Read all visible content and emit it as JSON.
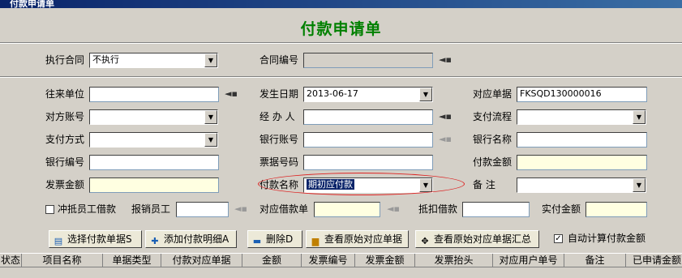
{
  "window": {
    "title": "付款申请单"
  },
  "header": {
    "title": "付款申请单"
  },
  "top": {
    "contract_label": "执行合同",
    "contract_value": "不执行",
    "contract_no_label": "合同编号",
    "contract_no_value": ""
  },
  "form": {
    "partner_label": "往来单位",
    "partner_value": "",
    "date_label": "发生日期",
    "date_value": "2013-06-17",
    "doc_label": "对应单据",
    "doc_value": "FKSQD130000016",
    "account_label": "对方账号",
    "account_value": "",
    "handler_label": "经 办 人",
    "handler_value": "",
    "flow_label": "支付流程",
    "flow_value": "",
    "paymethod_label": "支付方式",
    "paymethod_value": "",
    "bank_account_label": "银行账号",
    "bank_account_value": "",
    "bank_name_label": "银行名称",
    "bank_name_value": "",
    "bank_no_label": "银行编号",
    "bank_no_value": "",
    "bill_no_label": "票据号码",
    "bill_no_value": "",
    "pay_amount_label": "付款金额",
    "pay_amount_value": "",
    "invoice_amount_label": "发票金额",
    "invoice_amount_value": "",
    "pay_name_label": "付款名称",
    "pay_name_value": "期初应付款",
    "remark_label": "备  注",
    "remark_value": "",
    "offset_label": "冲抵员工借款",
    "offset_checked": false,
    "reimburse_label": "报销员工",
    "reimburse_value": "",
    "loan_doc_label": "对应借款单",
    "loan_doc_value": "",
    "deduct_label": "抵扣借款",
    "deduct_value": "",
    "actual_label": "实付金额",
    "actual_value": ""
  },
  "toolbar": {
    "select_doc": "选择付款单据S",
    "add_detail": "添加付款明细A",
    "delete": "删除D",
    "view_orig": "查看原始对应单据",
    "view_orig_summary": "查看原始对应单据汇总",
    "auto_calc_label": "自动计算付款金额",
    "auto_calc_checked": true
  },
  "grid": {
    "columns": [
      "状态",
      "项目名称",
      "单据类型",
      "付款对应单据",
      "金额",
      "发票编号",
      "发票金额",
      "发票抬头",
      "对应用户单号",
      "备注",
      "已申请金额"
    ]
  },
  "colors": {
    "title_green": "#008000",
    "highlight_red": "#dd2222",
    "yellow_field": "#ffffe1"
  }
}
